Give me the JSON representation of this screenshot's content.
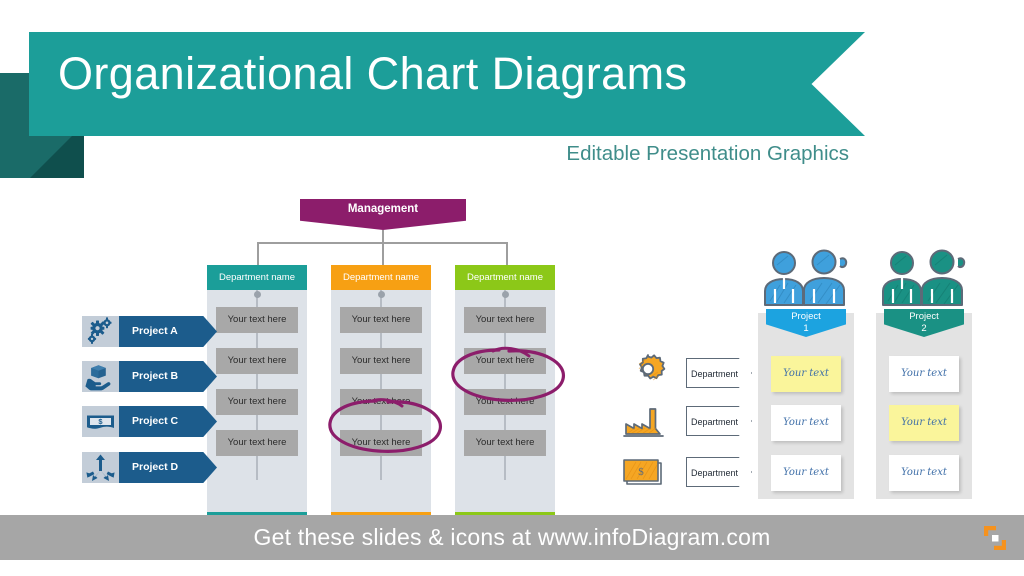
{
  "header": {
    "title": "Organizational Chart Diagrams",
    "subtitle": "Editable Presentation Graphics",
    "banner_color": "#1C9E99",
    "banner_shadow_color": "#1A6B68",
    "subtitle_color": "#3F8D8A"
  },
  "orgchart": {
    "management": {
      "label": "Management",
      "color": "#8C1D6B"
    },
    "departments": [
      {
        "label": "Department name",
        "color": "#1B9E99",
        "foot_color": "#1B9E99",
        "cells": [
          "Your text here",
          "Your text here",
          "Your text here",
          "Your text here"
        ]
      },
      {
        "label": "Department name",
        "color": "#F7A013",
        "foot_color": "#F7A013",
        "cells": [
          "Your text here",
          "Your text here",
          "Your text here",
          "Your text here"
        ]
      },
      {
        "label": "Department name",
        "color": "#8CC818",
        "foot_color": "#8CC818",
        "cells": [
          "Your text here",
          "Your text here",
          "Your text here",
          "Your text here"
        ]
      }
    ],
    "projects": [
      {
        "label": "Project A",
        "icon": "gears-icon"
      },
      {
        "label": "Project B",
        "icon": "hand-box-icon"
      },
      {
        "label": "Project C",
        "icon": "money-note-icon"
      },
      {
        "label": "Project D",
        "icon": "distribute-arrows-icon"
      }
    ],
    "project_pill_color": "#1C5C8C",
    "project_icon_bg": "#C3CDD8",
    "annotation_color": "#8C1D6B",
    "annotations": [
      {
        "target_column": 2,
        "target_row": 3
      },
      {
        "target_column": 3,
        "target_row": 2
      }
    ]
  },
  "matrix": {
    "rows": [
      {
        "label": "Department",
        "icon": "gear-sketch-icon"
      },
      {
        "label": "Department",
        "icon": "factory-sketch-icon"
      },
      {
        "label": "Department",
        "icon": "money-sketch-icon"
      }
    ],
    "columns": [
      {
        "label_line1": "Project",
        "label_line2": "1",
        "color": "#1CA3E0",
        "people_icon": "two-people-icon",
        "cells": [
          {
            "text": "Your text",
            "highlight": true
          },
          {
            "text": "Your text",
            "highlight": false
          },
          {
            "text": "Your text",
            "highlight": false
          }
        ]
      },
      {
        "label_line1": "Project",
        "label_line2": "2",
        "color": "#1A9184",
        "people_icon": "two-people-icon",
        "cells": [
          {
            "text": "Your text",
            "highlight": false
          },
          {
            "text": "Your text",
            "highlight": true
          },
          {
            "text": "Your text",
            "highlight": false
          }
        ]
      }
    ],
    "highlight_color": "#FAF59B",
    "cell_color": "#FFFFFF",
    "cell_text_color": "#3F6FA8",
    "icon_color": "#F5A623"
  },
  "footer": {
    "text": "Get these slides & icons at www.infoDiagram.com",
    "bar_color": "#A6A6A6",
    "logo_name": "infodiagram-logo-icon",
    "logo_color": "#F5921E"
  }
}
